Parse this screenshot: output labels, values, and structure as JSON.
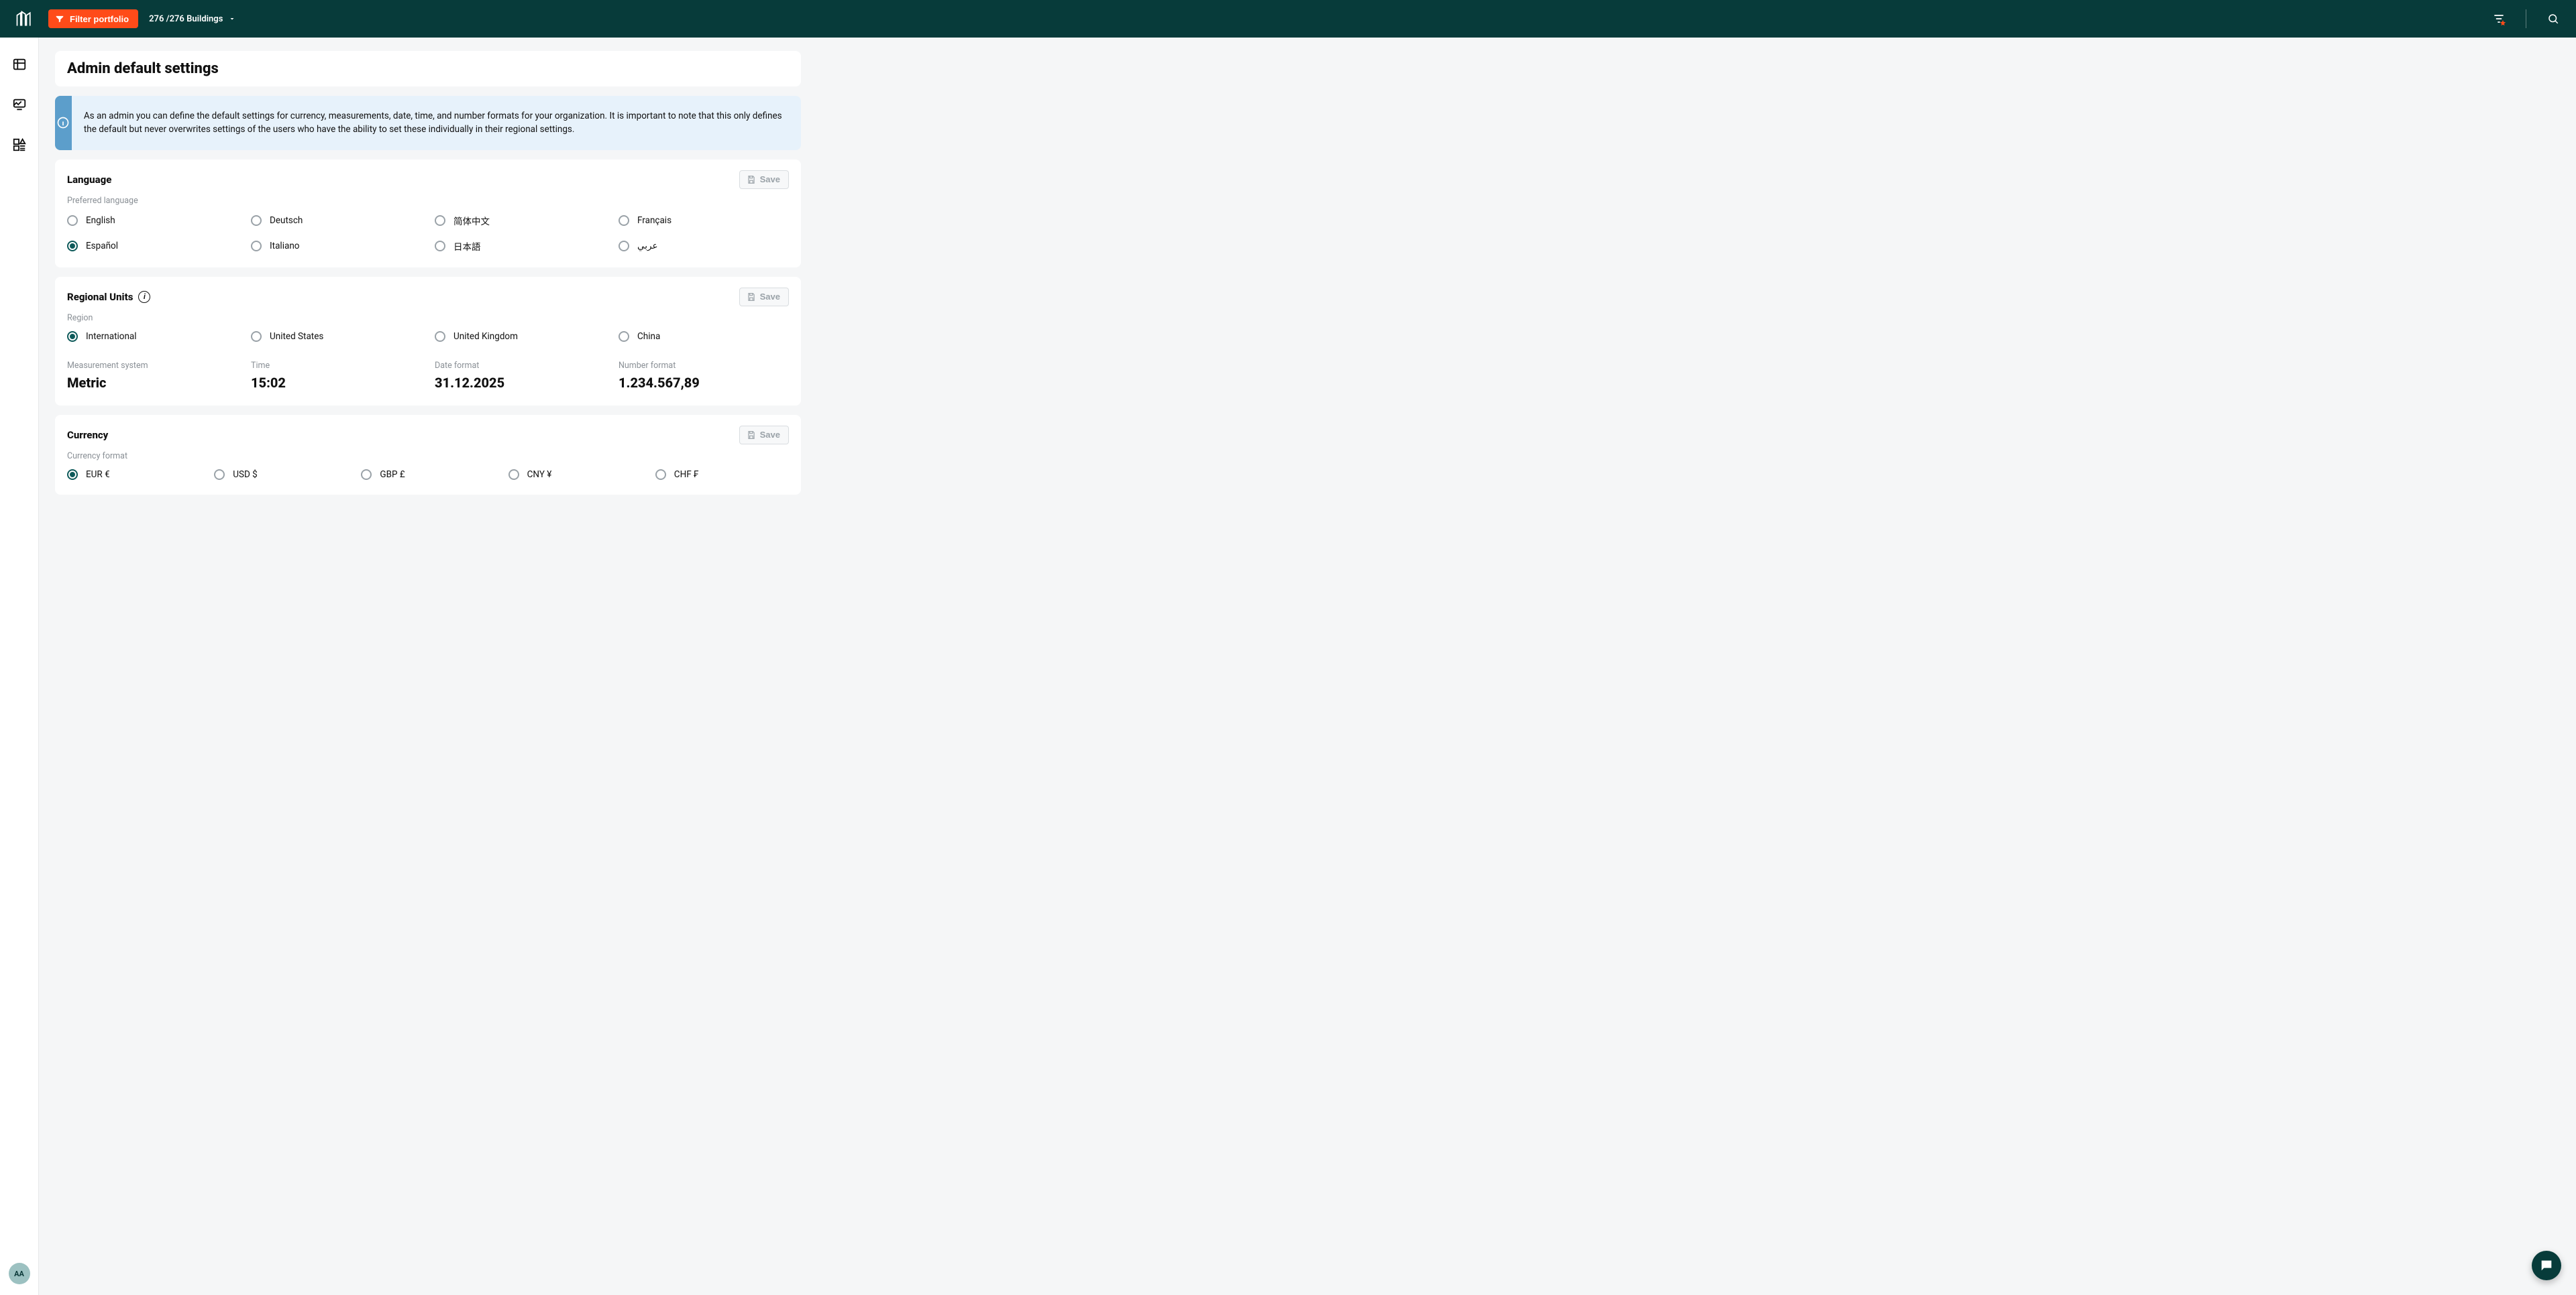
{
  "topbar": {
    "filter_label": "Filter portfolio",
    "building_count": "276 /276 Buildings"
  },
  "avatar": {
    "initials": "AA"
  },
  "page": {
    "title": "Admin default settings"
  },
  "info_banner": {
    "text": "As an admin you can define the default settings for currency, measurements, date, time, and number formats for your organization. It is important to note that this only defines the default but never overwrites settings of the users who have the ability to set these individually in their regional settings."
  },
  "common": {
    "save_label": "Save"
  },
  "language": {
    "title": "Language",
    "sublabel": "Preferred language",
    "options": [
      "English",
      "Deutsch",
      "简体中文",
      "Français",
      "Español",
      "Italiano",
      "日本語",
      "عربي"
    ],
    "selected": "Español"
  },
  "regional": {
    "title": "Regional Units",
    "sublabel": "Region",
    "options": [
      "International",
      "United States",
      "United Kingdom",
      "China"
    ],
    "selected": "International",
    "kv": {
      "measurement": {
        "label": "Measurement system",
        "value": "Metric"
      },
      "time": {
        "label": "Time",
        "value": "15:02"
      },
      "date": {
        "label": "Date format",
        "value": "31.12.2025"
      },
      "number": {
        "label": "Number format",
        "value": "1.234.567,89"
      }
    }
  },
  "currency": {
    "title": "Currency",
    "sublabel": "Currency format",
    "options": [
      "EUR €",
      "USD $",
      "GBP £",
      "CNY ¥",
      "CHF ₣"
    ],
    "selected": "EUR €"
  }
}
